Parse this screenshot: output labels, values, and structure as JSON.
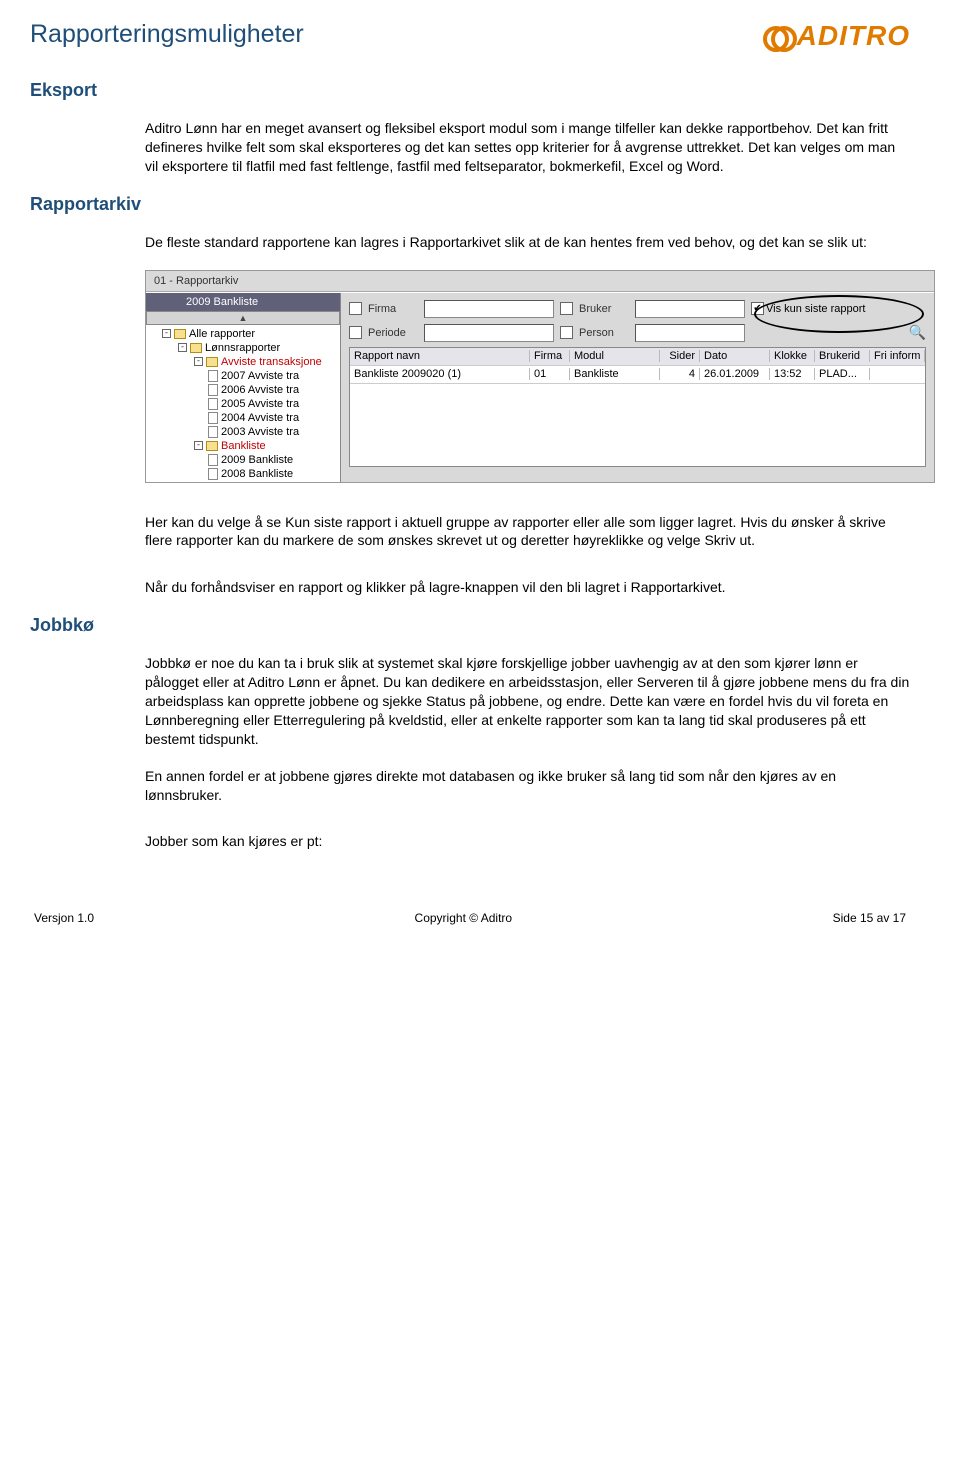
{
  "header": {
    "title": "Rapporteringsmuligheter",
    "logo_text": "ADITRO"
  },
  "sections": {
    "eksport": {
      "heading": "Eksport",
      "para1": "Aditro Lønn har en meget avansert og fleksibel eksport modul som i mange tilfeller kan dekke rapportbehov. Det kan fritt defineres hvilke felt som skal eksporteres og det kan settes opp kriterier for å avgrense uttrekket. Det kan velges om man vil eksportere til flatfil med fast feltlenge, fastfil med feltseparator, bokmerkefil, Excel og Word."
    },
    "rapportarkiv": {
      "heading": "Rapportarkiv",
      "intro": "De fleste standard rapportene kan lagres i Rapportarkivet slik at de kan hentes frem ved behov, og det kan se slik ut:",
      "after1": "Her kan du velge å se Kun siste rapport i aktuell gruppe av rapporter eller alle som ligger lagret. Hvis du ønsker å skrive flere rapporter kan du markere de som ønskes skrevet ut og deretter høyreklikke og velge Skriv ut.",
      "after2": "Når du forhåndsviser en rapport og klikker på lagre-knappen vil den bli lagret i Rapportarkivet."
    },
    "jobbko": {
      "heading": "Jobbkø",
      "p1": "Jobbkø er noe du kan ta i bruk slik at systemet skal kjøre forskjellige jobber uavhengig av at den som kjører lønn er pålogget eller at Aditro Lønn er åpnet. Du kan dedikere en arbeidsstasjon, eller Serveren til å gjøre jobbene mens du fra din arbeidsplass kan opprette jobbene og sjekke Status på jobbene, og endre. Dette kan være en fordel hvis du vil foreta en Lønnberegning eller Etterregulering på kveldstid, eller at enkelte rapporter som kan ta lang tid skal produseres på ett bestemt tidspunkt.",
      "p2": "En annen fordel er at jobbene gjøres direkte mot databasen og ikke bruker så lang tid som når den kjøres av en lønnsbruker.",
      "p3": "Jobber som kan kjøres er pt:"
    }
  },
  "screenshot": {
    "title_bar": "01 - Rapportarkiv",
    "tree_header": "2009 Bankliste",
    "tree": [
      {
        "lvl": 1,
        "exp": "-",
        "ico": "folder-open",
        "label": "Alle rapporter",
        "cls": ""
      },
      {
        "lvl": 2,
        "exp": "-",
        "ico": "folder-open",
        "label": "Lønnsrapporter",
        "cls": ""
      },
      {
        "lvl": 3,
        "exp": "-",
        "ico": "folder-open",
        "label": "Avviste transaksjone",
        "cls": "red"
      },
      {
        "lvl": 3,
        "exp": "",
        "ico": "doc",
        "label": "2007 Avviste tra",
        "cls": ""
      },
      {
        "lvl": 3,
        "exp": "",
        "ico": "doc",
        "label": "2006 Avviste tra",
        "cls": ""
      },
      {
        "lvl": 3,
        "exp": "",
        "ico": "doc",
        "label": "2005 Avviste tra",
        "cls": ""
      },
      {
        "lvl": 3,
        "exp": "",
        "ico": "doc",
        "label": "2004 Avviste tra",
        "cls": ""
      },
      {
        "lvl": 3,
        "exp": "",
        "ico": "doc",
        "label": "2003 Avviste tra",
        "cls": ""
      },
      {
        "lvl": 3,
        "exp": "-",
        "ico": "folder-open",
        "label": "Bankliste",
        "cls": "red"
      },
      {
        "lvl": 3,
        "exp": "",
        "ico": "doc",
        "label": "2009 Bankliste",
        "cls": ""
      },
      {
        "lvl": 3,
        "exp": "",
        "ico": "doc",
        "label": "2008 Bankliste",
        "cls": ""
      }
    ],
    "filters": {
      "firma_label": "Firma",
      "bruker_label": "Bruker",
      "vis_kun_label": "Vis kun siste rapport",
      "periode_label": "Periode",
      "person_label": "Person"
    },
    "grid": {
      "columns": [
        "Rapport navn",
        "Firma",
        "Modul",
        "Sider",
        "Dato",
        "Klokke",
        "Brukerid",
        "Fri inform"
      ],
      "row": {
        "name": "Bankliste 2009020 (1)",
        "firma": "01",
        "modul": "Bankliste",
        "sider": "4",
        "dato": "26.01.2009",
        "klokke": "13:52",
        "bruker": "PLAD..."
      }
    }
  },
  "footer": {
    "left": "Versjon 1.0",
    "center": "Copyright © Aditro",
    "right": "Side 15 av 17"
  }
}
